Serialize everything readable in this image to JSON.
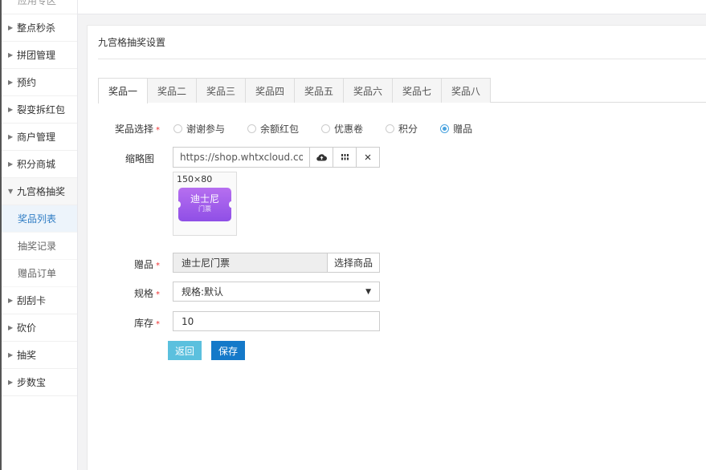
{
  "sidebar": {
    "top_label": "应用专区",
    "items": [
      {
        "label": "整点秒杀"
      },
      {
        "label": "拼团管理"
      },
      {
        "label": "预约"
      },
      {
        "label": "裂变拆红包"
      },
      {
        "label": "商户管理"
      },
      {
        "label": "积分商城"
      },
      {
        "label": "九宫格抽奖"
      }
    ],
    "subitems": [
      {
        "label": "奖品列表"
      },
      {
        "label": "抽奖记录"
      },
      {
        "label": "赠品订单"
      }
    ],
    "items_after": [
      {
        "label": "刮刮卡"
      },
      {
        "label": "砍价"
      },
      {
        "label": "抽奖"
      },
      {
        "label": "步数宝"
      }
    ]
  },
  "panel": {
    "title": "九宫格抽奖设置"
  },
  "tabs": [
    "奖品一",
    "奖品二",
    "奖品三",
    "奖品四",
    "奖品五",
    "奖品六",
    "奖品七",
    "奖品八"
  ],
  "form": {
    "prize_type_label": "奖品选择",
    "prize_options": [
      "谢谢参与",
      "余额红包",
      "优惠卷",
      "积分",
      "赠品"
    ],
    "selected_option": "赠品",
    "thumb_label": "缩略图",
    "thumb_url": "https://shop.whtxcloud.com/a",
    "thumb_size": "150×80",
    "ticket_name": "迪士尼",
    "ticket_sub": "门票",
    "gift_label": "赠品",
    "gift_value": "迪士尼门票",
    "gift_button": "选择商品",
    "spec_label": "规格",
    "spec_value": "规格:默认",
    "stock_label": "库存",
    "stock_value": "10",
    "required_mark": "*"
  },
  "actions": {
    "back": "返回",
    "save": "保存"
  },
  "colors": {
    "accent": "#1479c9",
    "back_button": "#5bc0de",
    "active_sub": "#2e7cc4",
    "radio_checked": "#4aa3df",
    "ticket_gradient_top": "#b66ff0",
    "ticket_gradient_bottom": "#8f4fe6"
  }
}
